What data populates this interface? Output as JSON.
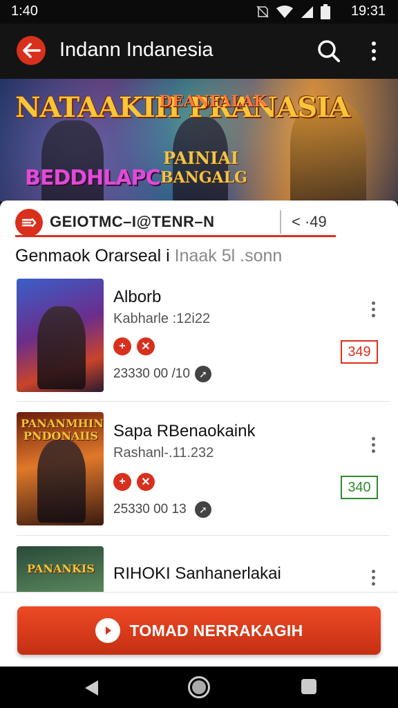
{
  "status_bar": {
    "time_left": "1:40",
    "time_right": "19:31"
  },
  "app_bar": {
    "title": "Indann Indanesia"
  },
  "banner": {
    "text_1": "NATAAKIH PRANASIA",
    "text_2": "BEDDHLAPC",
    "text_3": "BANGALG",
    "text_4": "PAINIAI",
    "text_5": "DEANFALAK"
  },
  "tab": {
    "label": "GEIOTMC–I@TENR–N",
    "count": "< ·49"
  },
  "section": {
    "title": "Genmaok Orarseal i",
    "title_light": " Inaak 5l .sonn"
  },
  "items": [
    {
      "title": "Alborb",
      "subtitle": "Kabharle :12i22",
      "meta": "23330 00 /10",
      "score": "349",
      "score_color": "#d9301e",
      "thumb_text": ""
    },
    {
      "title": "Sapa RBenaokaink",
      "subtitle": "Rashanl-.11.232",
      "meta": "25330 00 13",
      "score": "340",
      "score_color": "#2e8b2e",
      "thumb_text": "PANANMHIN PNDONAIIS"
    },
    {
      "title": "RIHOKI Sanhanerlakai",
      "thumb_text": "PANANKIS"
    }
  ],
  "cta": {
    "label": "TOMAD NERRAKAGIH"
  },
  "colors": {
    "accent": "#d9301e"
  }
}
